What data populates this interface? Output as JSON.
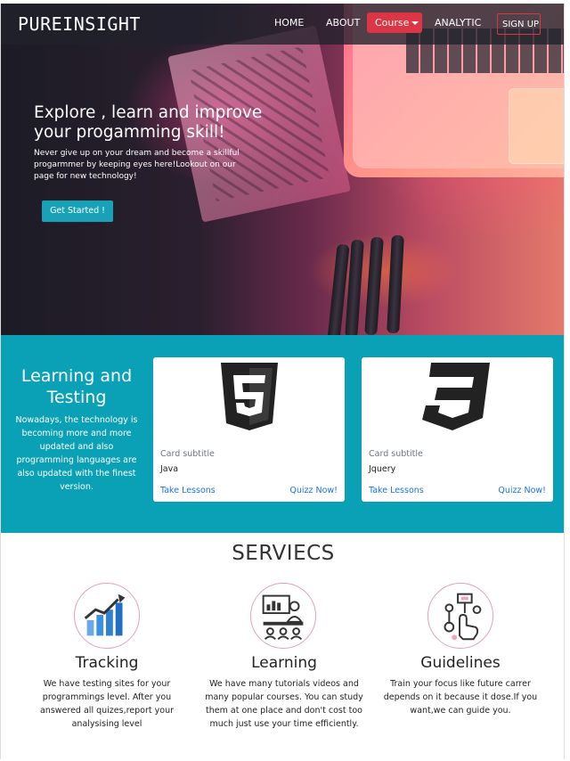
{
  "nav": {
    "brand": "PUREINSIGHT",
    "links": [
      "HOME",
      "ABOUT",
      "Course",
      "ANALYTIC"
    ],
    "signup": "SIGN UP"
  },
  "hero": {
    "title": "Explore , learn and improve your progamming skill!",
    "text": "Never give up on your dream and become a skillful progarmmer by keeping eyes here!Lookout on our page for new technology!",
    "button": "Get Started !"
  },
  "learning": {
    "title": "Learning and Testing",
    "text": "Nowadays, the technology is becoming more and more updated and also programming languages are also updated with the finest version.",
    "cards": [
      {
        "icon": "html5-icon",
        "subtitle": "Card subtitle",
        "name": "Java",
        "link1": "Take Lessons",
        "link2": "Quizz Now!"
      },
      {
        "icon": "css3-icon",
        "subtitle": "Card subtitle",
        "name": "Jquery",
        "link1": "Take Lessons",
        "link2": "Quizz Now!"
      }
    ]
  },
  "services": {
    "title": "SERVIECS",
    "items": [
      {
        "icon": "chart-growth-icon",
        "name": "Tracking",
        "text": "We have testing sites for your programmings level. After you answered all quizes,report your analysising level"
      },
      {
        "icon": "presentation-icon",
        "name": "Learning",
        "text": "We have many tutorials videos and many popular courses. You can study them at one place and don't cost too much just use your time efficiently."
      },
      {
        "icon": "touch-network-icon",
        "name": "Guidelines",
        "text": "Train your focus like future carrer depends on it because it dose.If you want,we can guide you."
      }
    ]
  },
  "colors": {
    "accent_teal": "#0aa1b6",
    "button_teal": "#17a2b8",
    "danger_red": "#dc3545",
    "link_blue": "#1a73e8",
    "circle_pink": "#e8a0b4"
  }
}
